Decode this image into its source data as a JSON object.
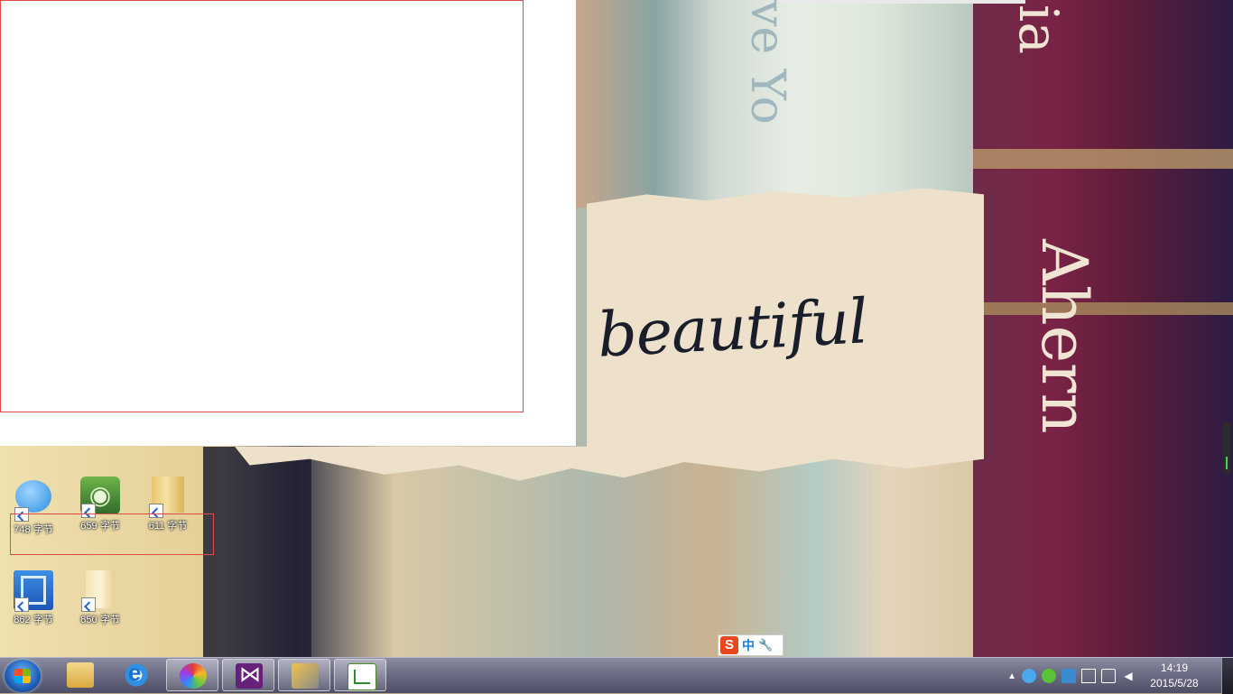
{
  "desktop": {
    "icons": [
      {
        "label": "748 字节",
        "icon": "qq-icon"
      },
      {
        "label": "659 字节",
        "icon": "evernote-icon"
      },
      {
        "label": "611 字节",
        "icon": "folder-icon"
      },
      {
        "label": "862 字节",
        "icon": "video-icon"
      },
      {
        "label": "850 字节",
        "icon": "folder-icon"
      }
    ]
  },
  "ime": {
    "logo": "S",
    "mode": "中",
    "tool": "🔧"
  },
  "wallpaper": {
    "word": "beautiful",
    "vertical_1": "ia",
    "vertical_2": "Ahern",
    "vertical_3": "ve Yo"
  },
  "taskbar": {
    "pinned": [
      "explorer-icon",
      "ie-icon",
      "pinwheel-icon",
      "visual-studio-icon",
      "tools-icon",
      "chart-app-icon"
    ],
    "tray": {
      "expand": "▲",
      "icons": [
        "qq-tray-icon",
        "wechat-icon",
        "edu-icon",
        "device-icon",
        "network-icon",
        "volume-icon"
      ]
    },
    "clock": {
      "time": "14:19",
      "date": "2015/5/28"
    }
  },
  "colors": {
    "selection_border": "#e04a4a",
    "taskbar": "#6c6c84"
  }
}
